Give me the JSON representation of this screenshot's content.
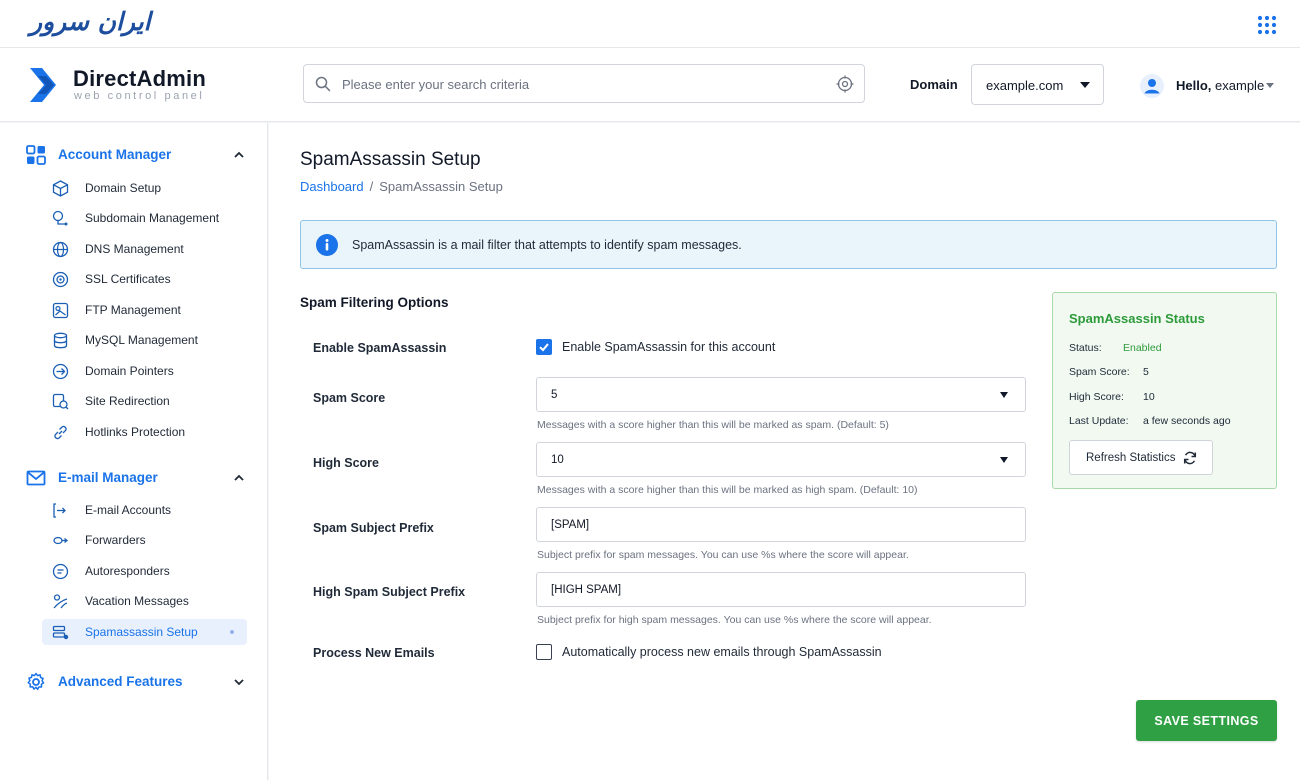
{
  "brand": {
    "logo_text": "ایران سرور"
  },
  "header": {
    "app_title": "DirectAdmin",
    "app_subtitle": "web control panel",
    "search_placeholder": "Please enter your search criteria",
    "domain_label": "Domain",
    "domain_value": "example.com",
    "greeting": "Hello,",
    "username": "example"
  },
  "sidebar": {
    "sections": [
      {
        "label": "Account Manager",
        "icon": "grid-icon",
        "expanded": true
      },
      {
        "label": "E-mail Manager",
        "icon": "envelope-icon",
        "expanded": true
      },
      {
        "label": "Advanced Features",
        "icon": "gear-icon",
        "expanded": false
      }
    ],
    "account_items": [
      {
        "label": "Domain Setup",
        "icon": "cube-icon"
      },
      {
        "label": "Subdomain Management",
        "icon": "subdomain-icon"
      },
      {
        "label": "DNS Management",
        "icon": "globe-icon"
      },
      {
        "label": "SSL Certificates",
        "icon": "certificate-icon"
      },
      {
        "label": "FTP Management",
        "icon": "ftp-icon"
      },
      {
        "label": "MySQL Management",
        "icon": "database-icon"
      },
      {
        "label": "Domain Pointers",
        "icon": "pointer-icon"
      },
      {
        "label": "Site Redirection",
        "icon": "redirect-icon"
      },
      {
        "label": "Hotlinks Protection",
        "icon": "link-icon"
      }
    ],
    "email_items": [
      {
        "label": "E-mail Accounts",
        "icon": "email-accounts-icon"
      },
      {
        "label": "Forwarders",
        "icon": "forward-icon"
      },
      {
        "label": "Autoresponders",
        "icon": "autoresponder-icon"
      },
      {
        "label": "Vacation Messages",
        "icon": "vacation-icon"
      },
      {
        "label": "Spamassassin Setup",
        "icon": "spam-filter-icon",
        "active": true
      }
    ]
  },
  "main": {
    "title": "SpamAssassin Setup",
    "breadcrumb_home": "Dashboard",
    "breadcrumb_sep": "/",
    "breadcrumb_current": "SpamAssassin Setup",
    "info_text": "SpamAssassin is a mail filter that attempts to identify spam messages.",
    "options_heading": "Spam Filtering Options",
    "form": {
      "enable_label": "Enable SpamAssassin",
      "enable_checkbox_text": "Enable SpamAssassin for this account",
      "enable_checked": true,
      "spam_score_label": "Spam Score",
      "spam_score_value": "5",
      "spam_score_help": "Messages with a score higher than this will be marked as spam. (Default: 5)",
      "high_score_label": "High Score",
      "high_score_value": "10",
      "high_score_help": "Messages with a score higher than this will be marked as high spam. (Default: 10)",
      "subject_prefix_label": "Spam Subject Prefix",
      "subject_prefix_value": "[SPAM]",
      "subject_prefix_help": "Subject prefix for spam messages. You can use %s where the score will appear.",
      "high_prefix_label": "High Spam Subject Prefix",
      "high_prefix_value": "[HIGH SPAM]",
      "high_prefix_help": "Subject prefix for high spam messages. You can use %s where the score will appear.",
      "process_label": "Process New Emails",
      "process_checkbox_text": "Automatically process new emails through SpamAssassin",
      "process_checked": false
    },
    "status": {
      "title": "SpamAssassin Status",
      "status_key": "Status:",
      "status_value": "Enabled",
      "spam_score_key": "Spam Score:",
      "spam_score_value": "5",
      "high_score_key": "High Score:",
      "high_score_value": "10",
      "last_update_key": "Last Update:",
      "last_update_value": "a few seconds ago",
      "refresh_label": "Refresh Statistics"
    },
    "save_label": "SAVE SETTINGS"
  },
  "colors": {
    "accent_blue": "#1a73e8",
    "brand_blue": "#1d4e9e",
    "status_green": "#2e9b3b",
    "save_green": "#2fa043",
    "info_bg": "#eaf4fb"
  }
}
